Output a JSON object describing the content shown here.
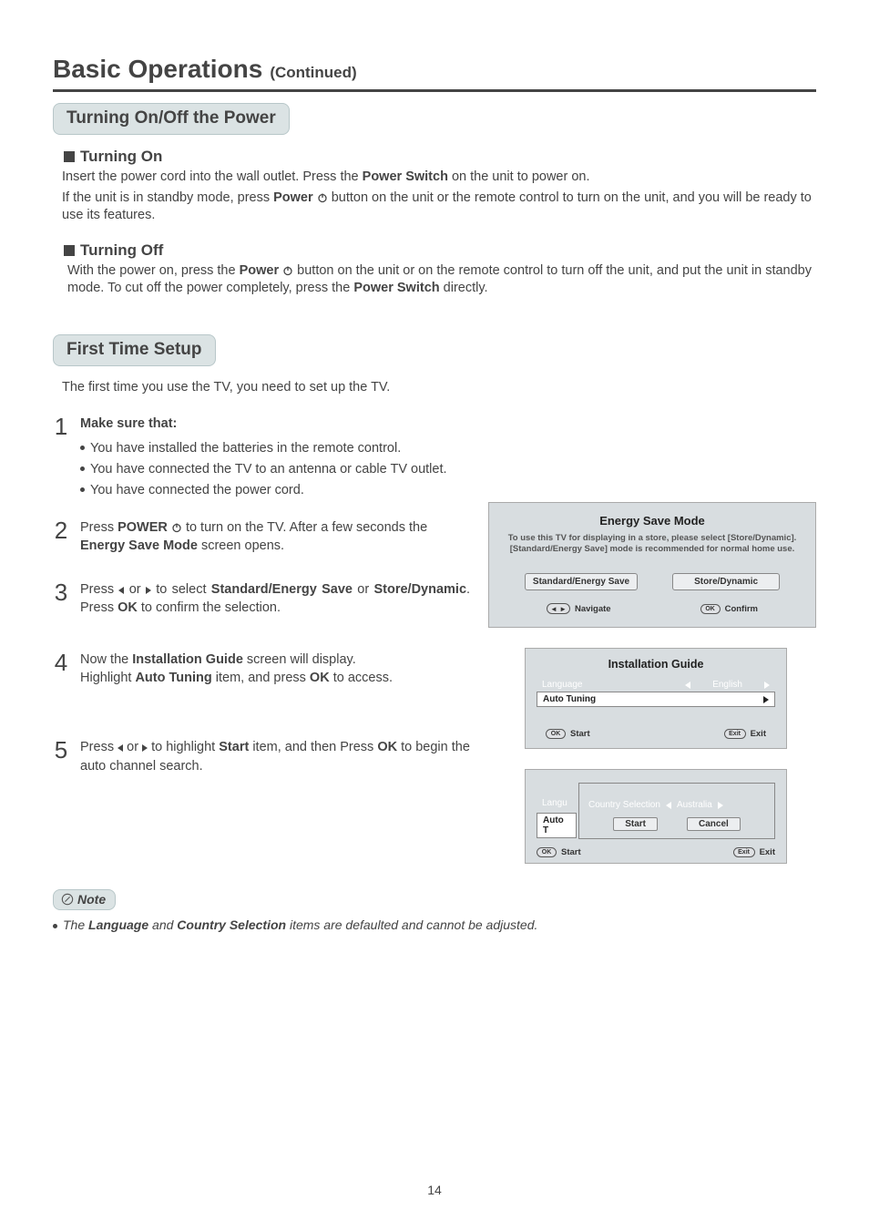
{
  "header": {
    "title": "Basic Operations",
    "subtitle": "(Continued)"
  },
  "s1": {
    "pill": "Turning On/Off the Power",
    "on_head": "Turning On",
    "on_p1a": "Insert the power cord into the wall outlet. Press the ",
    "on_p1b": "Power Switch",
    "on_p1c": " on the unit to power on.",
    "on_p2a": "If the unit is in standby mode, press ",
    "on_p2b": "Power",
    "on_p2c": " button on the unit or the remote control to turn on the unit, and you will be ready to use its features.",
    "off_head": "Turning Off",
    "off_p1a": "With the power on, press the ",
    "off_p1b": "Power",
    "off_p1c": " button on the unit or on the remote control to turn off the unit, and put the unit in standby mode. To cut off the power completely, press the ",
    "off_p1d": "Power Switch",
    "off_p1e": " directly."
  },
  "s2": {
    "pill": "First Time Setup",
    "intro": "The first time you use the TV, you need to set up the TV.",
    "step1_head": "Make sure that:",
    "bullets": [
      "You have installed the batteries in the remote control.",
      "You have connected the TV to an antenna or cable TV outlet.",
      "You have connected the power cord."
    ],
    "step2a": "Press ",
    "step2b": "POWER",
    "step2c": " to turn on the TV. After a few seconds the ",
    "step2d": "Energy Save Mode",
    "step2e": " screen opens.",
    "step3a": "Press ",
    "step3b": " or ",
    "step3c": " to select ",
    "step3d": "Standard/Energy Save",
    "step3e": " or ",
    "step3f": "Store/Dynamic",
    "step3g": ". Press ",
    "step3h": "OK",
    "step3i": " to confirm the selection.",
    "step4a": "Now the ",
    "step4b": "Installation Guide",
    "step4c": " screen will display.",
    "step4d": "Highlight ",
    "step4e": "Auto Tuning",
    "step4f": " item, and press ",
    "step4g": "OK",
    "step4h": " to access.",
    "step5a": "Press ",
    "step5b": " or ",
    "step5c": " to highlight ",
    "step5d": "Start",
    "step5e": " item, and then Press ",
    "step5f": "OK",
    "step5g": " to begin the auto channel search."
  },
  "osd1": {
    "title": "Energy Save Mode",
    "desc1": "To use this TV for displaying in a store, please select [Store/Dynamic].",
    "desc2": "[Standard/Energy Save] mode is recommended for normal home use.",
    "btn1": "Standard/Energy Save",
    "btn2": "Store/Dynamic",
    "hint1": "Navigate",
    "hint2": "Confirm",
    "ok": "OK"
  },
  "osd2": {
    "title": "Installation Guide",
    "row1_label": "Language",
    "row1_value": "English",
    "row2_label": "Auto Tuning",
    "hint1": "Start",
    "hint2": "Exit",
    "ok": "OK",
    "exit": "Exit"
  },
  "osd3": {
    "langu": "Langu",
    "auto": "Auto T",
    "cs_label": "Country Selection",
    "cs_value": "Australia",
    "btn1": "Start",
    "btn2": "Cancel",
    "hint1": "Start",
    "hint2": "Exit",
    "ok": "OK",
    "exit": "Exit"
  },
  "note": {
    "label": "Note",
    "line_a": "The ",
    "line_b": "Language",
    "line_c": " and ",
    "line_d": "Country Selection",
    "line_e": " items are defaulted and cannot be adjusted."
  },
  "page_number": "14"
}
